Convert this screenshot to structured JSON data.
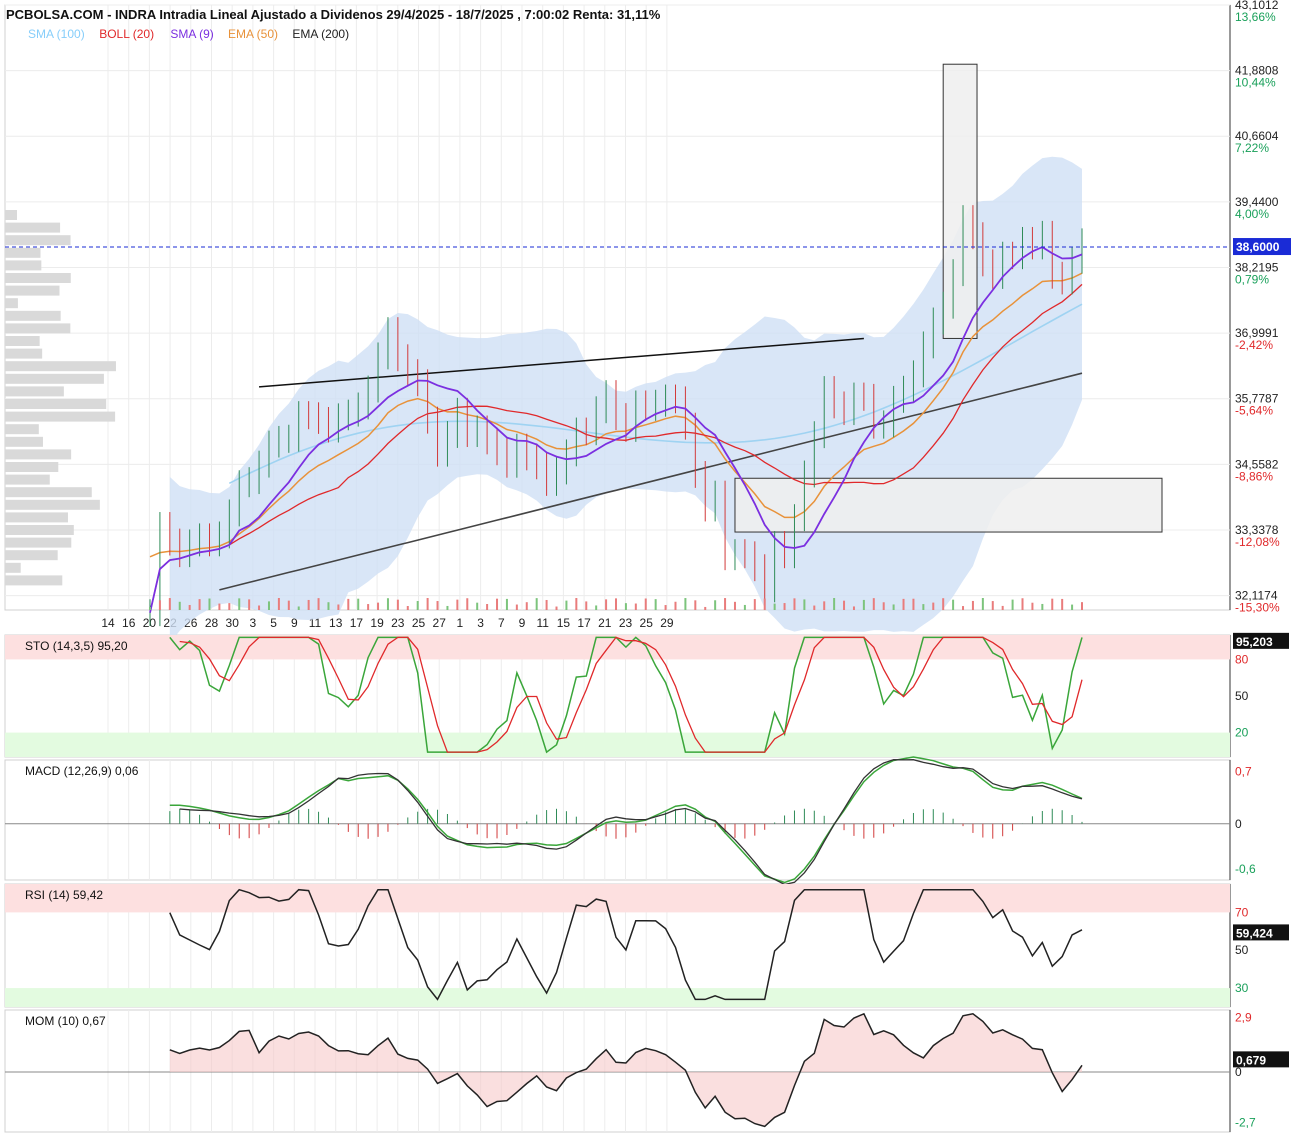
{
  "chart_data": {
    "type": "line",
    "title": "PCBOLSA.COM - INDRA Intradia Lineal Ajustado a Dividenos 29/4/2025 - 18/7/2025 , 7:00:02 Renta: 31,11%",
    "indicators_legend": [
      {
        "name": "SMA (100)",
        "color": "#87CEFA"
      },
      {
        "name": "BOLL (20)",
        "color": "#e0292b"
      },
      {
        "name": "SMA (9)",
        "color": "#7b2fe0"
      },
      {
        "name": "EMA (50)",
        "color": "#e8923a"
      },
      {
        "name": "EMA (200)",
        "color": "#222222"
      }
    ],
    "x_tick_labels": [
      "14",
      "16",
      "20",
      "22",
      "26",
      "28",
      "30",
      "3",
      "5",
      "9",
      "11",
      "13",
      "17",
      "19",
      "23",
      "25",
      "27",
      "1",
      "3",
      "7",
      "9",
      "11",
      "15",
      "17",
      "21",
      "23",
      "25",
      "29"
    ],
    "price_axis": {
      "ticks": [
        {
          "value": "43,1012",
          "pct": "13,66%"
        },
        {
          "value": "41,8808",
          "pct": "10,44%"
        },
        {
          "value": "40,6604",
          "pct": "7,22%"
        },
        {
          "value": "39,4400",
          "pct": "4,00%"
        },
        {
          "value": "38,2195",
          "pct": "0,79%"
        },
        {
          "value": "36,9991",
          "pct": "-2,42%"
        },
        {
          "value": "35,7787",
          "pct": "-5,64%"
        },
        {
          "value": "34,5582",
          "pct": "-8,86%"
        },
        {
          "value": "33,3378",
          "pct": "-12,08%"
        },
        {
          "value": "32,1174",
          "pct": "-15,30%"
        }
      ],
      "current_price": "38,6000",
      "ylim": [
        31.85,
        43.1012
      ]
    },
    "price_series": {
      "close_anchors": [
        [
          0,
          31.8
        ],
        [
          1,
          33.3
        ],
        [
          3,
          33.0
        ],
        [
          5,
          33.1
        ],
        [
          7,
          33.3
        ],
        [
          10,
          34.4
        ],
        [
          13,
          35.0
        ],
        [
          15,
          35.4
        ],
        [
          17,
          35.4
        ],
        [
          19,
          35.3
        ],
        [
          21,
          35.7
        ],
        [
          23,
          36.4
        ],
        [
          24,
          37.1
        ],
        [
          25,
          36.6
        ],
        [
          26,
          36.3
        ],
        [
          28,
          35.5
        ],
        [
          29,
          34.8
        ],
        [
          31,
          35.4
        ],
        [
          33,
          35.2
        ],
        [
          35,
          34.7
        ],
        [
          37,
          34.8
        ],
        [
          39,
          34.5
        ],
        [
          41,
          34.3
        ],
        [
          43,
          35.2
        ],
        [
          45,
          35.4
        ],
        [
          46,
          35.9
        ],
        [
          47,
          35.5
        ],
        [
          48,
          35.3
        ],
        [
          50,
          35.7
        ],
        [
          52,
          35.8
        ],
        [
          54,
          35.4
        ],
        [
          55,
          34.4
        ],
        [
          56,
          33.7
        ],
        [
          57,
          33.9
        ],
        [
          58,
          33.0
        ],
        [
          60,
          32.8
        ],
        [
          62,
          32.4
        ],
        [
          63,
          33.0
        ],
        [
          64,
          32.8
        ],
        [
          65,
          33.6
        ],
        [
          66,
          34.5
        ],
        [
          67,
          35.0
        ],
        [
          68,
          35.9
        ],
        [
          70,
          35.6
        ],
        [
          72,
          35.8
        ],
        [
          73,
          35.4
        ],
        [
          74,
          35.3
        ],
        [
          76,
          36.0
        ],
        [
          78,
          36.7
        ],
        [
          80,
          37.6
        ],
        [
          81,
          38.2
        ],
        [
          82,
          39.0
        ],
        [
          83,
          38.8
        ],
        [
          84,
          38.4
        ],
        [
          85,
          38.1
        ],
        [
          86,
          38.3
        ],
        [
          87,
          38.5
        ],
        [
          88,
          38.8
        ],
        [
          89,
          38.6
        ],
        [
          90,
          38.7
        ],
        [
          91,
          38.2
        ],
        [
          92,
          38.0
        ],
        [
          93,
          38.3
        ],
        [
          94,
          38.6
        ]
      ],
      "n_bars": 95,
      "y_range": [
        31.85,
        43.1012
      ]
    },
    "annotations": {
      "trendline": {
        "from": [
          11,
          36.0
        ],
        "to": [
          72,
          36.9
        ]
      },
      "zone_rect": {
        "x_from": 59,
        "x_to": 96,
        "y_low": 33.3,
        "y_high": 34.3
      },
      "tall_rect": {
        "x_from": 80,
        "x_to": 82,
        "y_low": 36.9,
        "y_high": 42.0
      }
    },
    "oscillators": [
      {
        "name": "STO (14,3,5)",
        "value": "95,20",
        "last": "95,203",
        "ticks": [
          "80",
          "50",
          "20"
        ],
        "ylim": [
          0,
          100
        ]
      },
      {
        "name": "MACD (12,26,9)",
        "value": "0,06",
        "ticks": [
          "0,7",
          "0",
          "-0,6"
        ],
        "ylim": [
          -0.75,
          0.85
        ]
      },
      {
        "name": "RSI (14)",
        "value": "59,42",
        "last": "59,424",
        "ticks": [
          "70",
          "50",
          "30"
        ],
        "ylim": [
          20,
          85
        ]
      },
      {
        "name": "MOM (10)",
        "value": "0,67",
        "last": "0,679",
        "ticks": [
          "2,9",
          "0",
          "-2,7"
        ],
        "ylim": [
          -3.2,
          3.3
        ]
      }
    ],
    "colors": {
      "stoch_fast": "#3aa63a",
      "stoch_slow": "#e0292b",
      "macd": "#3aa63a",
      "signal": "#333333",
      "rsi": "#222222",
      "mom": "#222222",
      "overbought": "#fde0e0",
      "oversold": "#e3fbe0",
      "bollinger_fill": "#cfe0f5",
      "current_price": "#1a2bd6"
    }
  }
}
